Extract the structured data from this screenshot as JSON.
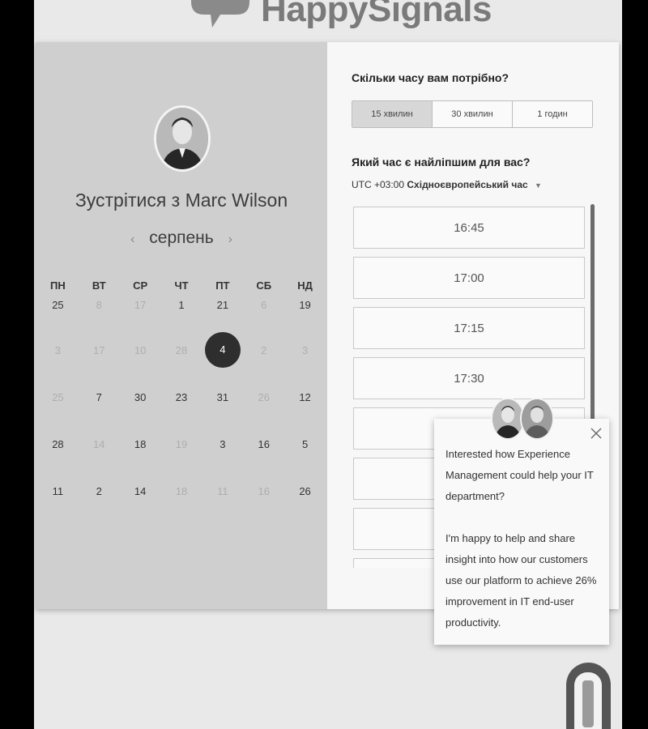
{
  "brand": {
    "name": "HappySignals"
  },
  "host": {
    "title_prefix": "Зустрітися з ",
    "name": "Marc Wilson"
  },
  "calendar": {
    "month": "серпень",
    "weekdays": [
      "ПН",
      "ВТ",
      "СР",
      "ЧТ",
      "ПТ",
      "СБ",
      "НД"
    ],
    "days": [
      {
        "label": "25",
        "muted": false
      },
      {
        "label": "8",
        "muted": true
      },
      {
        "label": "17",
        "muted": true
      },
      {
        "label": "1",
        "muted": false
      },
      {
        "label": "21",
        "muted": false
      },
      {
        "label": "6",
        "muted": true
      },
      {
        "label": "19",
        "muted": false
      },
      {
        "label": "3",
        "muted": true
      },
      {
        "label": "17",
        "muted": true
      },
      {
        "label": "10",
        "muted": true
      },
      {
        "label": "28",
        "muted": true
      },
      {
        "label": "4",
        "muted": false,
        "selected": true
      },
      {
        "label": "2",
        "muted": true
      },
      {
        "label": "3",
        "muted": true
      },
      {
        "label": "25",
        "muted": true
      },
      {
        "label": "7",
        "muted": false
      },
      {
        "label": "30",
        "muted": false
      },
      {
        "label": "23",
        "muted": false
      },
      {
        "label": "31",
        "muted": false
      },
      {
        "label": "26",
        "muted": true
      },
      {
        "label": "12",
        "muted": false
      },
      {
        "label": "28",
        "muted": false
      },
      {
        "label": "14",
        "muted": true
      },
      {
        "label": "18",
        "muted": false
      },
      {
        "label": "19",
        "muted": true
      },
      {
        "label": "3",
        "muted": false
      },
      {
        "label": "16",
        "muted": false
      },
      {
        "label": "5",
        "muted": false
      },
      {
        "label": "11",
        "muted": false
      },
      {
        "label": "2",
        "muted": false
      },
      {
        "label": "14",
        "muted": false
      },
      {
        "label": "18",
        "muted": true
      },
      {
        "label": "11",
        "muted": true
      },
      {
        "label": "16",
        "muted": true
      },
      {
        "label": "26",
        "muted": false
      }
    ]
  },
  "booking": {
    "duration_heading": "Скільки часу вам потрібно?",
    "durations": [
      "15 хвилин",
      "30 хвилин",
      "1 годин"
    ],
    "selected_duration": "15 хвилин",
    "time_heading": "Який час є найліпшим для вас?",
    "timezone_offset": "UTC +03:00",
    "timezone_name": "Східноєвропейський час",
    "slots": [
      "16:45",
      "17:00",
      "17:15",
      "17:30",
      "",
      "",
      "",
      ""
    ]
  },
  "chat": {
    "message_1": "Interested how Experience Management could help your IT department?",
    "message_2": "I'm happy to help and share insight into how our customers use our platform to achieve 26% improvement in IT end-user productivity."
  },
  "icons": {
    "logo": "speech-bubble-logo-icon",
    "close": "close-icon",
    "month_prev": "chevron-left-icon",
    "month_next": "chevron-right-icon",
    "tz_caret": "caret-down-icon",
    "launcher": "chat-launcher-icon"
  }
}
